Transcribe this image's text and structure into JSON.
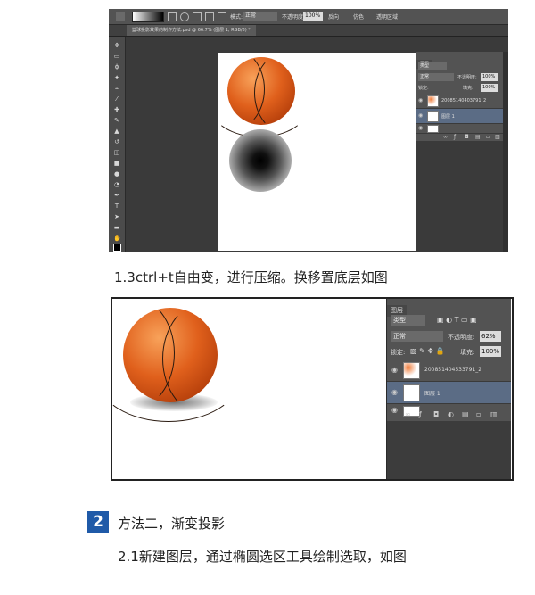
{
  "screenshot1": {
    "options_bar": {
      "mode_label": "模式:",
      "mode_value": "正常",
      "opacity_label": "不透明度:",
      "opacity_value": "100%",
      "reverse_label": "反向",
      "dither_label": "仿色",
      "transparency_label": "透明区域"
    },
    "document_tab": "篮球投影效果的制作方法.psd @ 66.7% (图层 1, RGB/8) *",
    "layers_panel": {
      "tab": "图层",
      "filter_label": "类型",
      "blend_mode": "正常",
      "opacity_label": "不透明度:",
      "opacity_value": "100%",
      "lock_label": "锁定:",
      "fill_label": "填充:",
      "fill_value": "100%",
      "layers": [
        {
          "name": "2008514040379­1_2",
          "selected": false
        },
        {
          "name": "图层 1",
          "selected": true
        },
        {
          "name": "",
          "selected": false
        }
      ]
    }
  },
  "caption1": "1.3ctrl+t自由变，进行压缩。换移置底层如图",
  "screenshot2": {
    "layers_panel": {
      "tab": "图层",
      "filter_label": "类型",
      "blend_mode": "正常",
      "opacity_label": "不透明度:",
      "opacity_value": "62%",
      "lock_label": "锁定:",
      "fill_label": "填充:",
      "fill_value": "100%",
      "layers": [
        {
          "name": "20085140453379­1_2",
          "selected": false
        },
        {
          "name": "图层 1",
          "selected": true
        },
        {
          "name": "",
          "selected": false
        }
      ]
    }
  },
  "step": {
    "number": "2",
    "title": "方法二，渐变投影"
  },
  "caption2": "2.1新建图层，通过椭圆选区工具绘制选取，如图"
}
